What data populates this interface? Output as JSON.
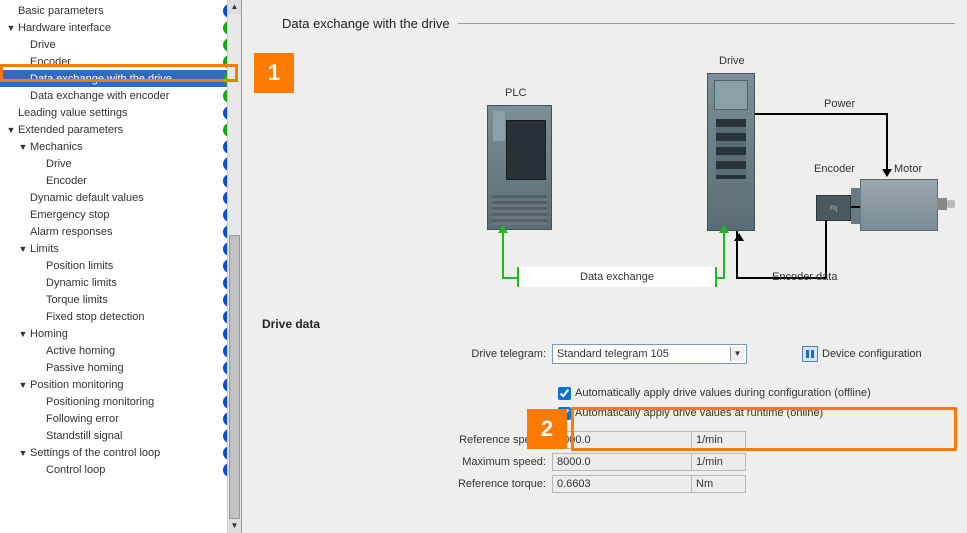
{
  "tree": [
    {
      "label": "Basic parameters",
      "indent": 0,
      "exp": "",
      "status": "blue",
      "selected": false
    },
    {
      "label": "Hardware interface",
      "indent": 0,
      "exp": "▼",
      "status": "green",
      "selected": false
    },
    {
      "label": "Drive",
      "indent": 1,
      "exp": "",
      "status": "green",
      "selected": false
    },
    {
      "label": "Encoder",
      "indent": 1,
      "exp": "",
      "status": "green",
      "selected": false
    },
    {
      "label": "Data exchange with the drive",
      "indent": 1,
      "exp": "",
      "status": "green",
      "selected": true
    },
    {
      "label": "Data exchange with encoder",
      "indent": 1,
      "exp": "",
      "status": "green",
      "selected": false
    },
    {
      "label": "Leading value settings",
      "indent": 0,
      "exp": "",
      "status": "blue",
      "selected": false
    },
    {
      "label": "Extended parameters",
      "indent": 0,
      "exp": "▼",
      "status": "green",
      "selected": false
    },
    {
      "label": "Mechanics",
      "indent": 1,
      "exp": "▼",
      "status": "blue",
      "selected": false
    },
    {
      "label": "Drive",
      "indent": 2,
      "exp": "",
      "status": "blue",
      "selected": false
    },
    {
      "label": "Encoder",
      "indent": 2,
      "exp": "",
      "status": "blue",
      "selected": false
    },
    {
      "label": "Dynamic default values",
      "indent": 1,
      "exp": "",
      "status": "blue",
      "selected": false
    },
    {
      "label": "Emergency stop",
      "indent": 1,
      "exp": "",
      "status": "blue",
      "selected": false
    },
    {
      "label": "Alarm responses",
      "indent": 1,
      "exp": "",
      "status": "blue",
      "selected": false
    },
    {
      "label": "Limits",
      "indent": 1,
      "exp": "▼",
      "status": "blue",
      "selected": false
    },
    {
      "label": "Position limits",
      "indent": 2,
      "exp": "",
      "status": "blue",
      "selected": false
    },
    {
      "label": "Dynamic limits",
      "indent": 2,
      "exp": "",
      "status": "blue",
      "selected": false
    },
    {
      "label": "Torque limits",
      "indent": 2,
      "exp": "",
      "status": "blue",
      "selected": false
    },
    {
      "label": "Fixed stop detection",
      "indent": 2,
      "exp": "",
      "status": "blue",
      "selected": false
    },
    {
      "label": "Homing",
      "indent": 1,
      "exp": "▼",
      "status": "blue",
      "selected": false
    },
    {
      "label": "Active homing",
      "indent": 2,
      "exp": "",
      "status": "blue",
      "selected": false
    },
    {
      "label": "Passive homing",
      "indent": 2,
      "exp": "",
      "status": "blue",
      "selected": false
    },
    {
      "label": "Position monitoring",
      "indent": 1,
      "exp": "▼",
      "status": "blue",
      "selected": false
    },
    {
      "label": "Positioning monitoring",
      "indent": 2,
      "exp": "",
      "status": "blue",
      "selected": false
    },
    {
      "label": "Following error",
      "indent": 2,
      "exp": "",
      "status": "blue",
      "selected": false
    },
    {
      "label": "Standstill signal",
      "indent": 2,
      "exp": "",
      "status": "blue",
      "selected": false
    },
    {
      "label": "Settings of the control loop",
      "indent": 1,
      "exp": "▼",
      "status": "blue",
      "selected": false
    },
    {
      "label": "Control loop",
      "indent": 2,
      "exp": "",
      "status": "blue",
      "selected": false
    }
  ],
  "header": {
    "title": "Data exchange with the drive"
  },
  "diagram": {
    "plc": "PLC",
    "drive": "Drive",
    "power": "Power",
    "encoder": "Encoder",
    "motor": "Motor",
    "dex": "Data exchange",
    "encdata": "Encoder data"
  },
  "driveData": {
    "section": "Drive data",
    "telegramLabel": "Drive telegram:",
    "telegramValue": "Standard telegram 105",
    "devConfig": "Device configuration",
    "cb1": "Automatically apply drive values during configuration (offline)",
    "cb2": "Automatically apply drive values at runtime (online)",
    "refSpeedLabel": "Reference speed:",
    "refSpeedValue": "8000.0",
    "refSpeedUnit": "1/min",
    "maxSpeedLabel": "Maximum speed:",
    "maxSpeedValue": "8000.0",
    "maxSpeedUnit": "1/min",
    "refTorqueLabel": "Reference torque:",
    "refTorqueValue": "0.6603",
    "refTorqueUnit": "Nm"
  },
  "callouts": {
    "c1": "1",
    "c2": "2"
  }
}
